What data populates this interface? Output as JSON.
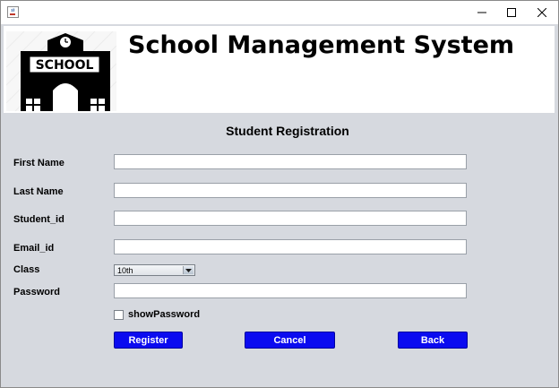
{
  "window": {
    "icons": {
      "app": "java-cup-icon",
      "minimize": "minimize-icon",
      "maximize": "maximize-icon",
      "close": "close-icon"
    }
  },
  "banner": {
    "logo_text": "SCHOOL",
    "logo_icon": "school-building-icon",
    "title": "School Management System"
  },
  "form": {
    "title": "Student Registration",
    "fields": {
      "first_name": {
        "label": "First Name",
        "value": ""
      },
      "last_name": {
        "label": "Last Name",
        "value": ""
      },
      "student_id": {
        "label": "Student_id",
        "value": ""
      },
      "email_id": {
        "label": "Email_id",
        "value": ""
      },
      "class": {
        "label": "Class",
        "selected": "10th"
      },
      "password": {
        "label": "Password",
        "value": ""
      }
    },
    "show_password": {
      "label": "showPassword",
      "checked": false
    },
    "buttons": {
      "register": "Register",
      "cancel": "Cancel",
      "back": "Back"
    }
  },
  "colors": {
    "accent_button": "#0b0bf0",
    "background": "#d6d9df"
  }
}
